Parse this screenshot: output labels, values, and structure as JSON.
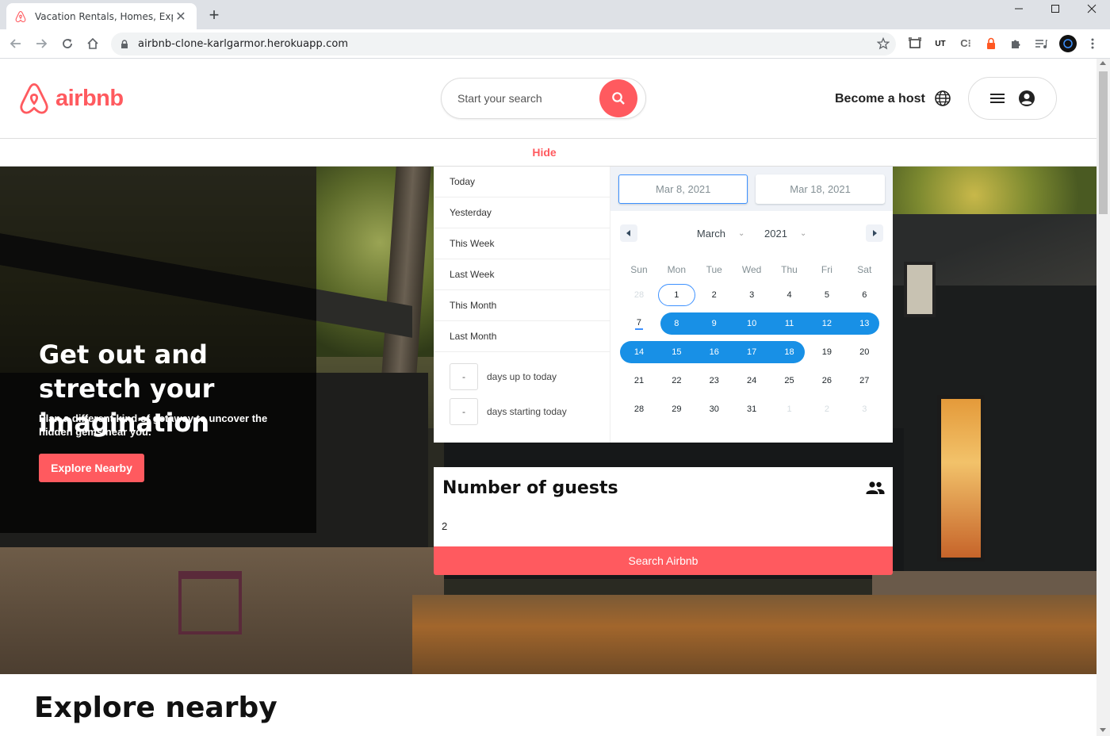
{
  "browser": {
    "tab_title": "Vacation Rentals, Homes, Experie",
    "url": "airbnb-clone-karlgarmor.herokuapp.com"
  },
  "header": {
    "logo_text": "airbnb",
    "search_placeholder": "Start your search",
    "become_host": "Become a host"
  },
  "hide_label": "Hide",
  "hero": {
    "title": "Get out and stretch your imagination",
    "subtitle": "Plan a different kind of getaway to uncover the hidden gems near you.",
    "button": "Explore Nearby"
  },
  "datepicker": {
    "static_ranges": [
      "Today",
      "Yesterday",
      "This Week",
      "Last Week",
      "This Month",
      "Last Month"
    ],
    "input_ranges": [
      {
        "value": "-",
        "label": "days up to today"
      },
      {
        "value": "-",
        "label": "days starting today"
      }
    ],
    "start_date": "Mar 8, 2021",
    "end_date": "Mar 18, 2021",
    "month": "March",
    "year": "2021",
    "weekdays": [
      "Sun",
      "Mon",
      "Tue",
      "Wed",
      "Thu",
      "Fri",
      "Sat"
    ],
    "weeks": [
      [
        "28",
        "1",
        "2",
        "3",
        "4",
        "5",
        "6"
      ],
      [
        "7",
        "8",
        "9",
        "10",
        "11",
        "12",
        "13"
      ],
      [
        "14",
        "15",
        "16",
        "17",
        "18",
        "19",
        "20"
      ],
      [
        "21",
        "22",
        "23",
        "24",
        "25",
        "26",
        "27"
      ],
      [
        "28",
        "29",
        "30",
        "31",
        "1",
        "2",
        "3"
      ]
    ]
  },
  "guests": {
    "title": "Number of guests",
    "value": "2",
    "search_button": "Search Airbnb"
  },
  "explore_heading": "Explore nearby",
  "colors": {
    "brand": "#ff5a5f",
    "range": "#1890e6",
    "accent": "#3d91ff"
  }
}
